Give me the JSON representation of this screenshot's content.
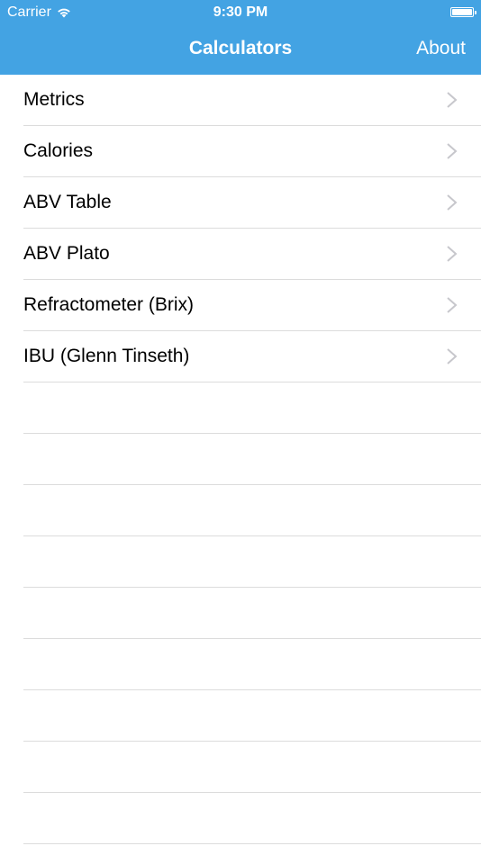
{
  "status_bar": {
    "carrier": "Carrier",
    "time": "9:30 PM",
    "battery_level": 1.0
  },
  "nav": {
    "title": "Calculators",
    "about_label": "About"
  },
  "colors": {
    "nav_background": "#43a3e3",
    "separator": "#dcdcdc",
    "chevron": "#c7c7cc"
  },
  "menu": {
    "items": [
      {
        "label": "Metrics",
        "icon": "chevron-right-icon"
      },
      {
        "label": "Calories",
        "icon": "chevron-right-icon"
      },
      {
        "label": "ABV Table",
        "icon": "chevron-right-icon"
      },
      {
        "label": "ABV Plato",
        "icon": "chevron-right-icon"
      },
      {
        "label": "Refractometer (Brix)",
        "icon": "chevron-right-icon"
      },
      {
        "label": "IBU (Glenn Tinseth)",
        "icon": "chevron-right-icon"
      }
    ]
  }
}
